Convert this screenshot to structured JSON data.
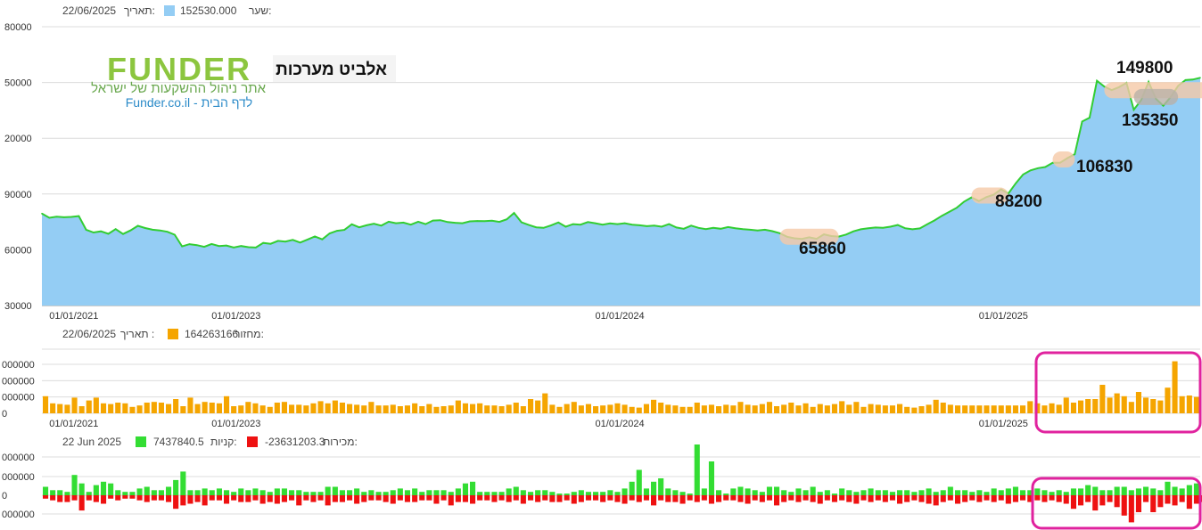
{
  "price_panel": {
    "date_label": "תאריך:",
    "date_value": "22/06/2025",
    "series_label": "שער:",
    "series_value": "152530.000",
    "brand_logo": "FUNDER",
    "brand_tagline": "אתר ניהול ההשקעות של ישראל",
    "brand_link": "Funder.co.il - לדף הבית",
    "stock_name": "אלביט מערכות"
  },
  "volume_panel": {
    "date_label": "תאריך :",
    "date_value": "22/06/2025",
    "series_label": "מחזור:",
    "series_value": "164263166"
  },
  "flow_panel": {
    "date_value": "22 Jun 2025",
    "buys_label": "קניות:",
    "buys_value": "7437840.5",
    "sells_label": "מכירות:",
    "sells_value": "-23631203.3"
  },
  "colors": {
    "area_fill": "#94cdf4",
    "line": "#32cd32",
    "volume_bar": "#f5a500",
    "buy_bar": "#33dd33",
    "sell_bar": "#ee1111",
    "highlight_box": "#e0229e",
    "peak_marker": "#f5c9a8",
    "trough_marker": "#b8b0a8"
  },
  "chart_data": [
    {
      "type": "area",
      "series": [
        {
          "name": "שער",
          "values": [
            79500,
            77200,
            77800,
            77500,
            77700,
            78100,
            70800,
            69300,
            69900,
            68600,
            71100,
            68500,
            70400,
            72900,
            71700,
            70800,
            70400,
            69700,
            68100,
            61800,
            63000,
            62500,
            61600,
            63100,
            62000,
            62300,
            61200,
            62000,
            61400,
            61200,
            63700,
            63200,
            64800,
            64400,
            65300,
            63900,
            65500,
            67200,
            65600,
            68800,
            70200,
            70700,
            73700,
            72100,
            73200,
            74000,
            73000,
            75100,
            74300,
            74600,
            73500,
            75100,
            73800,
            75700,
            75900,
            74900,
            74500,
            74300,
            75300,
            75500,
            75400,
            75600,
            75000,
            76400,
            79800,
            74800,
            73300,
            72100,
            71800,
            73100,
            74700,
            72400,
            73800,
            73500,
            74900,
            74300,
            73500,
            74200,
            73800,
            74300,
            73500,
            73200,
            72700,
            73000,
            72400,
            73800,
            72000,
            71300,
            73000,
            71800,
            71100,
            71800,
            71300,
            72200,
            71600,
            71100,
            70800,
            70400,
            70800,
            70000,
            68900,
            67000,
            66200,
            65860,
            66700,
            65900,
            68300,
            67400,
            67100,
            68200,
            69900,
            71000,
            71600,
            72000,
            71800,
            72400,
            73300,
            71600,
            71000,
            71500,
            73700,
            75800,
            78300,
            80400,
            82600,
            85900,
            88200,
            86200,
            88300,
            89600,
            92500,
            90300,
            95800,
            100500,
            102700,
            103900,
            104500,
            106800,
            106830,
            109300,
            111400,
            129000,
            131000,
            150900,
            147800,
            145900,
            147500,
            149800,
            135350,
            140500,
            150300,
            141200,
            137500,
            142200,
            148200,
            151300,
            151600,
            152530
          ]
        }
      ],
      "x_tick_labels": [
        "01/01/2021",
        "01/01/2023",
        "01/01/2024",
        "01/01/2025"
      ],
      "y_tick_labels": [
        "80000",
        "50000",
        "20000",
        "90000",
        "60000",
        "30000"
      ],
      "annotations": [
        "65860",
        "88200",
        "106830",
        "149800",
        "135350"
      ]
    },
    {
      "type": "bar",
      "series": [
        {
          "name": "מחזור",
          "values": [
            24,
            14,
            13,
            12,
            22,
            10,
            18,
            22,
            14,
            13,
            15,
            14,
            9,
            11,
            15,
            16,
            15,
            13,
            20,
            10,
            22,
            13,
            16,
            15,
            14,
            24,
            10,
            11,
            16,
            14,
            11,
            9,
            15,
            16,
            12,
            12,
            11,
            14,
            17,
            14,
            18,
            15,
            13,
            12,
            11,
            16,
            11,
            11,
            12,
            10,
            11,
            14,
            10,
            13,
            9,
            10,
            11,
            18,
            14,
            13,
            14,
            11,
            11,
            10,
            12,
            15,
            10,
            20,
            18,
            28,
            12,
            9,
            13,
            16,
            11,
            13,
            10,
            11,
            12,
            14,
            12,
            9,
            8,
            13,
            19,
            15,
            12,
            11,
            9,
            9,
            15,
            11,
            12,
            10,
            12,
            11,
            16,
            12,
            11,
            13,
            16,
            10,
            12,
            15,
            11,
            14,
            9,
            13,
            11,
            13,
            17,
            12,
            16,
            9,
            13,
            12,
            11,
            11,
            13,
            9,
            8,
            10,
            12,
            19,
            15,
            12,
            11,
            11,
            11,
            11,
            11,
            11,
            11,
            11,
            11,
            11,
            17,
            14,
            11,
            14,
            12,
            22,
            15,
            18,
            20,
            20,
            40,
            22,
            28,
            24,
            16,
            30,
            22,
            20,
            18,
            36,
            73,
            24,
            25,
            23
          ]
        }
      ],
      "x_tick_labels": [
        "01/01/2021",
        "01/01/2023",
        "01/01/2024",
        "01/01/2025"
      ],
      "y_tick_labels": [
        "000000",
        "000000",
        "000000",
        "0"
      ]
    },
    {
      "type": "bar",
      "series": [
        {
          "name": "קניות",
          "values": [
            5,
            3,
            3,
            2,
            12,
            7,
            2,
            6,
            8,
            7,
            3,
            2,
            2,
            4,
            5,
            3,
            3,
            5,
            9,
            14,
            3,
            3,
            4,
            3,
            4,
            3,
            2,
            4,
            3,
            4,
            3,
            2,
            4,
            4,
            3,
            3,
            2,
            2,
            2,
            5,
            5,
            3,
            3,
            4,
            2,
            3,
            2,
            2,
            3,
            4,
            3,
            4,
            2,
            3,
            3,
            3,
            2,
            4,
            7,
            8,
            2,
            2,
            2,
            2,
            4,
            5,
            3,
            2,
            3,
            3,
            2,
            1,
            1,
            2,
            3,
            2,
            2,
            2,
            3,
            2,
            4,
            8,
            15,
            4,
            8,
            10,
            4,
            3,
            2,
            1,
            30,
            4,
            20,
            3,
            1,
            4,
            5,
            4,
            3,
            2,
            5,
            5,
            3,
            2,
            4,
            3,
            5,
            2,
            3,
            1,
            4,
            3,
            2,
            3,
            4,
            3,
            3,
            2,
            3,
            3,
            2,
            3,
            4,
            2,
            3,
            5,
            3,
            3,
            2,
            3,
            2,
            4,
            3,
            4,
            5,
            3,
            3,
            4,
            3,
            2,
            3,
            2,
            4,
            4,
            6,
            5,
            3,
            3,
            5,
            5,
            3,
            4,
            5,
            4,
            3,
            8,
            5,
            4,
            6,
            7
          ]
        },
        {
          "name": "מכירות",
          "values": [
            -2,
            -3,
            -4,
            -4,
            -3,
            -9,
            -3,
            -4,
            -5,
            -2,
            -3,
            -2,
            -2,
            -3,
            -4,
            -3,
            -3,
            -4,
            -8,
            -6,
            -5,
            -4,
            -6,
            -3,
            -3,
            -5,
            -3,
            -4,
            -4,
            -3,
            -5,
            -4,
            -5,
            -4,
            -3,
            -6,
            -3,
            -4,
            -3,
            -6,
            -4,
            -4,
            -3,
            -5,
            -4,
            -3,
            -3,
            -4,
            -5,
            -3,
            -4,
            -4,
            -3,
            -3,
            -5,
            -3,
            -6,
            -4,
            -4,
            -5,
            -3,
            -3,
            -4,
            -3,
            -4,
            -3,
            -5,
            -3,
            -4,
            -3,
            -4,
            -4,
            -3,
            -5,
            -4,
            -3,
            -3,
            -4,
            -3,
            -4,
            -5,
            -3,
            -4,
            -3,
            -6,
            -3,
            -4,
            -4,
            -5,
            -3,
            -4,
            -3,
            -5,
            -4,
            -3,
            -3,
            -4,
            -5,
            -3,
            -4,
            -3,
            -6,
            -4,
            -3,
            -4,
            -3,
            -4,
            -5,
            -3,
            -4,
            -3,
            -4,
            -5,
            -3,
            -4,
            -3,
            -4,
            -3,
            -5,
            -4,
            -3,
            -4,
            -5,
            -6,
            -4,
            -3,
            -5,
            -4,
            -3,
            -4,
            -3,
            -4,
            -3,
            -5,
            -4,
            -3,
            -4,
            -3,
            -4,
            -3,
            -4,
            -5,
            -8,
            -6,
            -4,
            -9,
            -6,
            -4,
            -7,
            -12,
            -16,
            -10,
            -4,
            -10,
            -7,
            -5,
            -6,
            -4,
            -8,
            -5,
            -4,
            -9,
            -4,
            -5
          ]
        }
      ],
      "x_tick_labels": [],
      "y_tick_labels": [
        "000000",
        "000000",
        "0",
        "000000"
      ]
    }
  ]
}
